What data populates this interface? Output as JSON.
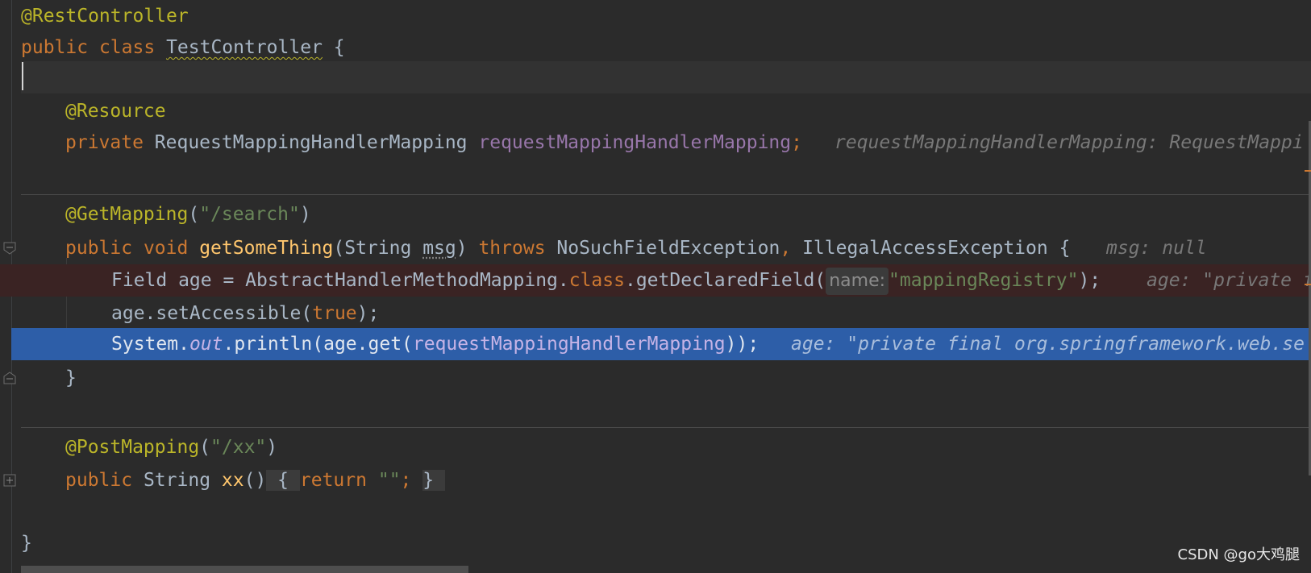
{
  "lines": {
    "l1": {
      "annotation": "@RestController"
    },
    "l2": {
      "kw_public": "public",
      "kw_class": "class",
      "class_name": "TestController",
      "brace": "{"
    },
    "l4": {
      "annotation": "@Resource"
    },
    "l5": {
      "kw_private": "private",
      "type": "RequestMappingHandlerMapping",
      "field": "requestMappingHandlerMapping",
      "semi": ";",
      "hint": "requestMappingHandlerMapping: RequestMappi"
    },
    "l7": {
      "annotation": "@GetMapping",
      "open": "(",
      "path": "\"/search\"",
      "close": ")"
    },
    "l8": {
      "kw_public": "public",
      "kw_void": "void",
      "method": "getSomeThing",
      "open": "(",
      "param_type": "String",
      "param": "msg",
      "close": ")",
      "kw_throws": "throws",
      "ex1": "NoSuchFieldException",
      "comma": ",",
      "ex2": "IllegalAccessException",
      "brace": "{",
      "hint": "msg: null"
    },
    "l9": {
      "pre": "Field age = AbstractHandlerMethodMapping.",
      "kw_class": "class",
      "call": ".getDeclaredField(",
      "param_hint": "name:",
      "arg": "\"mappingRegistry\"",
      "close": ");",
      "hint": "age: \"private f"
    },
    "l10": {
      "pre": "age.setAccessible(",
      "kw_true": "true",
      "close": ");"
    },
    "l11": {
      "pre": "System.",
      "out": "out",
      "mid": ".println(age.get(",
      "field": "requestMappingHandlerMapping",
      "close": "));",
      "hint": "age: \"private final org.springframework.web.se"
    },
    "l12": {
      "brace": "}"
    },
    "l14": {
      "annotation": "@PostMapping",
      "open": "(",
      "path": "\"/xx\"",
      "close": ")"
    },
    "l15": {
      "kw_public": "public",
      "type": "String",
      "method": "xx",
      "parens": "()",
      "fold_open": "{",
      "kw_return": "return",
      "str": "\"\"",
      "semi": ";",
      "fold_close": "}"
    },
    "l17": {
      "brace": "}"
    }
  },
  "watermark": "CSDN @go大鸡腿",
  "colors": {
    "background": "#2b2b2b",
    "keyword": "#cc7832",
    "annotation": "#bbb529",
    "string": "#6a8759",
    "field": "#9876aa",
    "method": "#ffc66d",
    "text": "#a9b7c6",
    "execution_line": "#2d5ea8",
    "breakpoint_line": "#3a2323"
  },
  "icons": [
    "fold-collapse-icon",
    "fold-end-icon",
    "fold-expand-icon"
  ]
}
